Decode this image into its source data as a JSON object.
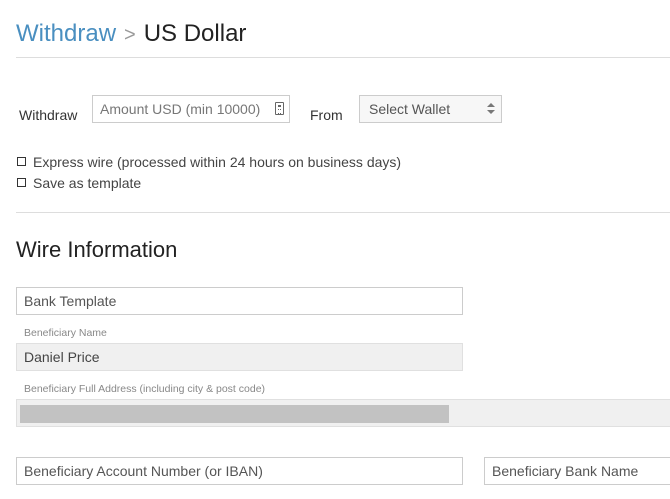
{
  "header": {
    "breadcrumb_link": "Withdraw",
    "breadcrumb_separator": ">",
    "breadcrumb_current": "US Dollar"
  },
  "withdraw_form": {
    "withdraw_label": "Withdraw",
    "amount_placeholder": "Amount USD (min 10000)",
    "from_label": "From",
    "wallet_select_value": "Select Wallet",
    "express_wire_label": "Express wire (processed within 24 hours on business days)",
    "save_template_label": "Save as template"
  },
  "wire_information": {
    "title": "Wire Information",
    "bank_template_value": "Bank Template",
    "beneficiary_name_label": "Beneficiary Name",
    "beneficiary_name_value": "Daniel Price",
    "beneficiary_address_label": "Beneficiary Full Address (including city & post code)",
    "account_number_value": "Beneficiary Account Number (or IBAN)",
    "bank_name_value": "Beneficiary Bank Name"
  },
  "icons": {
    "calculator": "calculator-icon",
    "select_arrows": "sort-arrows-icon"
  },
  "colors": {
    "link": "#4a8fc0",
    "redaction": "#c2c2c2"
  }
}
